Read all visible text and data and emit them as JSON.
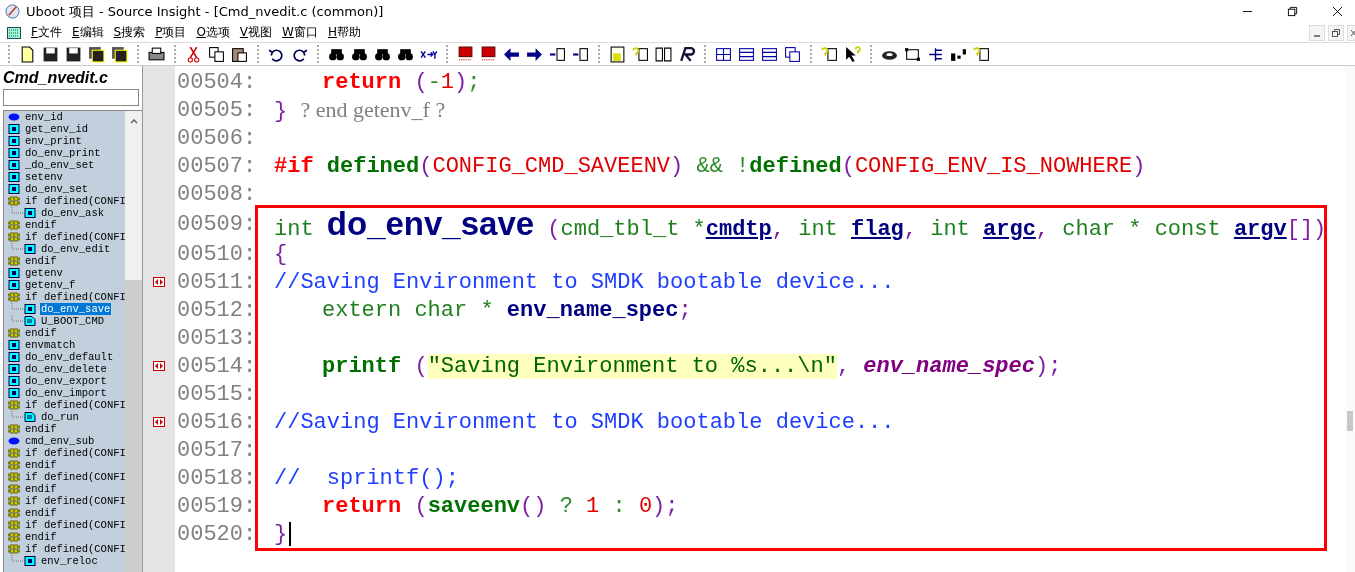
{
  "window": {
    "title": "Uboot 项目 - Source Insight - [Cmd_nvedit.c (common)]"
  },
  "menu": [
    {
      "key": "F",
      "label": "文件"
    },
    {
      "key": "E",
      "label": "编辑"
    },
    {
      "key": "S",
      "label": "搜索"
    },
    {
      "key": "P",
      "label": "项目"
    },
    {
      "key": "O",
      "label": "选项"
    },
    {
      "key": "V",
      "label": "视图"
    },
    {
      "key": "W",
      "label": "窗口"
    },
    {
      "key": "H",
      "label": "帮助"
    }
  ],
  "symbol_panel": {
    "title": "Cmd_nvedit.c",
    "items": [
      {
        "label": "env_id",
        "kind": "enum",
        "selected": false
      },
      {
        "label": "get_env_id",
        "kind": "func",
        "selected": false
      },
      {
        "label": "env_print",
        "kind": "func",
        "selected": false
      },
      {
        "label": "do_env_print",
        "kind": "func",
        "selected": false
      },
      {
        "label": "_do_env_set",
        "kind": "func",
        "selected": false
      },
      {
        "label": "setenv",
        "kind": "func",
        "selected": false
      },
      {
        "label": "do_env_set",
        "kind": "func",
        "selected": false
      },
      {
        "label": "if defined(CONFI",
        "kind": "cond",
        "selected": false,
        "children": [
          {
            "label": "do_env_ask",
            "kind": "func",
            "selected": false
          }
        ]
      },
      {
        "label": "endif",
        "kind": "cond",
        "selected": false
      },
      {
        "label": "if defined(CONFI",
        "kind": "cond",
        "selected": false,
        "children": [
          {
            "label": "do_env_edit",
            "kind": "func",
            "selected": false
          }
        ]
      },
      {
        "label": "endif",
        "kind": "cond",
        "selected": false
      },
      {
        "label": "getenv",
        "kind": "func",
        "selected": false
      },
      {
        "label": "getenv_f",
        "kind": "func",
        "selected": false
      },
      {
        "label": "if defined(CONFI",
        "kind": "cond",
        "selected": false,
        "children": [
          {
            "label": "do_env_save",
            "kind": "func",
            "selected": true
          },
          {
            "label": "U_BOOT_CMD",
            "kind": "file",
            "selected": false
          }
        ]
      },
      {
        "label": "endif",
        "kind": "cond",
        "selected": false
      },
      {
        "label": "envmatch",
        "kind": "func",
        "selected": false
      },
      {
        "label": "do_env_default",
        "kind": "func",
        "selected": false
      },
      {
        "label": "do_env_delete",
        "kind": "func",
        "selected": false
      },
      {
        "label": "do_env_export",
        "kind": "func",
        "selected": false
      },
      {
        "label": "do_env_import",
        "kind": "func",
        "selected": false
      },
      {
        "label": "if defined(CONFI",
        "kind": "cond",
        "selected": false,
        "children": [
          {
            "label": "do_run",
            "kind": "file",
            "selected": false
          }
        ]
      },
      {
        "label": "endif",
        "kind": "cond",
        "selected": false
      },
      {
        "label": "cmd_env_sub",
        "kind": "enum",
        "selected": false
      },
      {
        "label": "if defined(CONFI",
        "kind": "cond",
        "selected": false
      },
      {
        "label": "endif",
        "kind": "cond",
        "selected": false
      },
      {
        "label": "if defined(CONFI",
        "kind": "cond",
        "selected": false
      },
      {
        "label": "endif",
        "kind": "cond",
        "selected": false
      },
      {
        "label": "if defined(CONFI",
        "kind": "cond",
        "selected": false
      },
      {
        "label": "endif",
        "kind": "cond",
        "selected": false
      },
      {
        "label": "if defined(CONFI",
        "kind": "cond",
        "selected": false
      },
      {
        "label": "endif",
        "kind": "cond",
        "selected": false
      },
      {
        "label": "if defined(CONFI",
        "kind": "cond",
        "selected": false,
        "children": [
          {
            "label": "env_reloc",
            "kind": "func",
            "selected": false
          }
        ]
      }
    ]
  },
  "editor": {
    "lines": [
      {
        "number": "00504:",
        "indented": true,
        "bookmark": false,
        "tokens": [
          {
            "text": "return ",
            "kind": "keyword"
          },
          {
            "text": "(",
            "kind": "punct"
          },
          {
            "text": "-",
            "kind": "op"
          },
          {
            "text": "1",
            "kind": "number"
          },
          {
            "text": ")",
            "kind": "punct"
          },
          {
            "text": ";",
            "kind": "op"
          }
        ]
      },
      {
        "number": "00505:",
        "indented": false,
        "bookmark": false,
        "tokens": [
          {
            "text": "} ",
            "kind": "punct"
          },
          {
            "text": "? end getenv_f ?",
            "kind": "annotation"
          }
        ]
      },
      {
        "number": "00506:",
        "bookmark": false
      },
      {
        "number": "00507:",
        "indented": false,
        "bookmark": false,
        "tokens": [
          {
            "text": "#if ",
            "kind": "keyword"
          },
          {
            "text": "defined",
            "kind": "call"
          },
          {
            "text": "(",
            "kind": "punct"
          },
          {
            "text": "CONFIG_CMD_SAVEENV",
            "kind": "macro"
          },
          {
            "text": ") ",
            "kind": "punct"
          },
          {
            "text": "&& !",
            "kind": "op"
          },
          {
            "text": "defined",
            "kind": "call"
          },
          {
            "text": "(",
            "kind": "punct"
          },
          {
            "text": "CONFIG_ENV_IS_NOWHERE",
            "kind": "macro"
          },
          {
            "text": ")",
            "kind": "punct"
          }
        ]
      },
      {
        "number": "00508:",
        "bookmark": false
      }
    ],
    "highlight": {
      "lines": [
        {
          "number": "00509:",
          "indented": false,
          "bookmark": false,
          "tokens": [
            {
              "text": "int ",
              "kind": "type"
            },
            {
              "text": "do_env_save",
              "kind": "definition"
            },
            {
              "text": " (",
              "kind": "punct"
            },
            {
              "text": "cmd_tbl_t *",
              "kind": "type"
            },
            {
              "text": "cmdtp",
              "kind": "param"
            },
            {
              "text": ", ",
              "kind": "punct"
            },
            {
              "text": "int ",
              "kind": "type"
            },
            {
              "text": "flag",
              "kind": "param"
            },
            {
              "text": ", ",
              "kind": "punct"
            },
            {
              "text": "int ",
              "kind": "type"
            },
            {
              "text": "argc",
              "kind": "param"
            },
            {
              "text": ", ",
              "kind": "punct"
            },
            {
              "text": "char * const ",
              "kind": "type"
            },
            {
              "text": "argv",
              "kind": "param"
            },
            {
              "text": "[])",
              "kind": "punct"
            }
          ]
        },
        {
          "number": "00510:",
          "indented": false,
          "bookmark": false,
          "tokens": [
            {
              "text": "{",
              "kind": "punct"
            }
          ]
        },
        {
          "number": "00511:",
          "indented": false,
          "bookmark": true,
          "tokens": [
            {
              "text": "//Saving Environment to SMDK bootable device...",
              "kind": "comment"
            }
          ]
        },
        {
          "number": "00512:",
          "indented": true,
          "bookmark": false,
          "tokens": [
            {
              "text": "extern char * ",
              "kind": "type"
            },
            {
              "text": "env_name_spec",
              "kind": "declared"
            },
            {
              "text": ";",
              "kind": "punct"
            }
          ]
        },
        {
          "number": "00513:",
          "bookmark": false
        },
        {
          "number": "00514:",
          "indented": true,
          "bookmark": true,
          "tokens": [
            {
              "text": "printf ",
              "kind": "call"
            },
            {
              "text": "(",
              "kind": "punct"
            },
            {
              "text": "\"Saving Environment to %s...\\n\"",
              "kind": "string"
            },
            {
              "text": ", ",
              "kind": "punct"
            },
            {
              "text": "env_name_spec",
              "kind": "reference"
            },
            {
              "text": ");",
              "kind": "punct"
            }
          ]
        },
        {
          "number": "00515:",
          "bookmark": false
        },
        {
          "number": "00516:",
          "indented": false,
          "bookmark": true,
          "tokens": [
            {
              "text": "//Saving Environment to SMDK bootable device...",
              "kind": "comment"
            }
          ]
        },
        {
          "number": "00517:",
          "bookmark": false
        },
        {
          "number": "00518:",
          "indented": false,
          "bookmark": false,
          "tokens": [
            {
              "text": "//  sprintf();",
              "kind": "comment"
            }
          ]
        },
        {
          "number": "00519:",
          "indented": true,
          "bookmark": false,
          "tokens": [
            {
              "text": "return ",
              "kind": "keyword"
            },
            {
              "text": "(",
              "kind": "punct"
            },
            {
              "text": "saveenv",
              "kind": "call"
            },
            {
              "text": "() ",
              "kind": "punct"
            },
            {
              "text": "? ",
              "kind": "op"
            },
            {
              "text": "1",
              "kind": "number"
            },
            {
              "text": " : ",
              "kind": "op"
            },
            {
              "text": "0",
              "kind": "number"
            },
            {
              "text": ");",
              "kind": "punct"
            }
          ]
        },
        {
          "number": "00520:",
          "indented": false,
          "bookmark": false,
          "caret": true,
          "tokens": [
            {
              "text": "}",
              "kind": "punct"
            }
          ]
        }
      ]
    }
  }
}
